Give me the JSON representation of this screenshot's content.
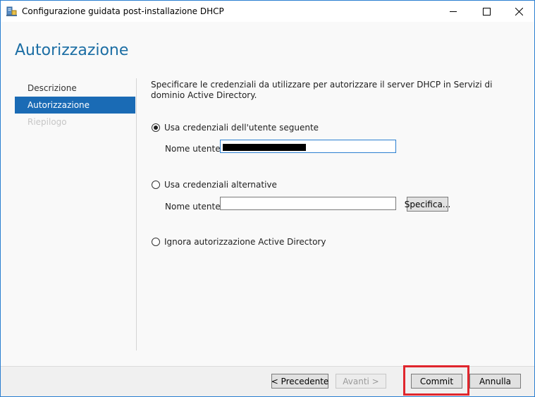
{
  "window": {
    "title": "Configurazione guidata post-installazione DHCP",
    "icon": "dhcp-server-icon",
    "controls": {
      "minimize": "minimize-icon",
      "maximize": "maximize-icon",
      "close": "close-icon"
    }
  },
  "page": {
    "title": "Autorizzazione"
  },
  "nav": {
    "items": [
      {
        "label": "Descrizione",
        "state": "normal"
      },
      {
        "label": "Autorizzazione",
        "state": "active"
      },
      {
        "label": "Riepilogo",
        "state": "disabled"
      }
    ]
  },
  "content": {
    "intro": "Specificare le credenziali da utilizzare per autorizzare il server DHCP in Servizi di dominio Active Directory.",
    "options": [
      {
        "label": "Usa credenziali dell'utente seguente",
        "checked": true
      },
      {
        "label": "Usa credenziali alternative",
        "checked": false
      },
      {
        "label": "Ignora autorizzazione Active Directory",
        "checked": false
      }
    ],
    "user_label_1": "Nome utente:",
    "user_value_1": "",
    "user_label_2": "Nome utente:",
    "user_value_2": "",
    "specify_button": "Specifica..."
  },
  "footer": {
    "prev": "< Precedente",
    "next": "Avanti >",
    "commit": "Commit",
    "cancel": "Annulla"
  },
  "colors": {
    "accent": "#1a6bb5",
    "title": "#1c6ea4",
    "highlight": "#e0262d"
  }
}
